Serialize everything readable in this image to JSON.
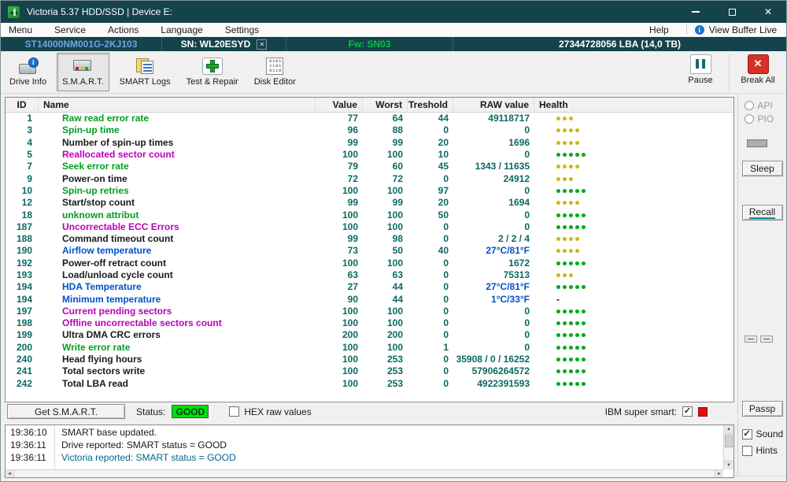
{
  "window": {
    "title": "Victoria 5.37 HDD/SSD | Device E:"
  },
  "icons": {
    "app-icon": "green-drive-logo",
    "minimize-icon": "—",
    "maximize-icon": "▢",
    "close-icon": "✕",
    "view-buffer-info-icon": "ℹ",
    "pause-icon": "❚❚",
    "break-all-icon": "✕",
    "scroll-up": "▲",
    "scroll-down": "▼",
    "scroll-left": "◄",
    "scroll-right": "►"
  },
  "colors": {
    "titlebar_bg": "#15434c",
    "green": "#00a020",
    "black": "#1a1a1a",
    "magenta": "#bb00bb",
    "blue": "#0050cc",
    "value_teal": "#0a6a62",
    "health_green": "#00a81e",
    "health_yellow": "#c9b919",
    "log_blue": "#006688",
    "status_good_bg": "#00e010",
    "model_blue": "#6ea6e0",
    "fw_green": "#00c341",
    "text_black": "#1a1a1a"
  },
  "menu": {
    "items": [
      "Menu",
      "Service",
      "Actions",
      "Language",
      "Settings"
    ],
    "help": "Help",
    "view_buffer_live": "View Buffer Live"
  },
  "device": {
    "model": "ST14000NM001G-2KJ103",
    "serial": "SN: WL20ESYD",
    "firmware": "Fw: SN03",
    "capacity": "27344728056 LBA (14,0 TB)"
  },
  "toolbar": {
    "buttons": [
      {
        "label": "Drive Info",
        "icon": "drive-info-icon",
        "active": false
      },
      {
        "label": "S.M.A.R.T.",
        "icon": "smart-icon",
        "active": true
      },
      {
        "label": "SMART Logs",
        "icon": "smart-logs-icon",
        "active": false
      },
      {
        "label": "Test & Repair",
        "icon": "test-repair-icon",
        "active": false
      },
      {
        "label": "Disk Editor",
        "icon": "disk-editor-icon",
        "active": false
      }
    ],
    "pause_label": "Pause",
    "break_all_label": "Break All"
  },
  "table": {
    "headers": [
      "ID",
      "Name",
      "Value",
      "Worst",
      "Treshold",
      "RAW value",
      "Health"
    ],
    "rows": [
      {
        "id": "1",
        "name": "Raw read error rate",
        "name_color": "green",
        "value": "77",
        "worst": "64",
        "threshold": "44",
        "raw": "49118717",
        "health": {
          "dots": 3,
          "color": "yellow"
        }
      },
      {
        "id": "3",
        "name": "Spin-up time",
        "name_color": "green",
        "value": "96",
        "worst": "88",
        "threshold": "0",
        "raw": "0",
        "health": {
          "dots": 4,
          "color": "yellow"
        }
      },
      {
        "id": "4",
        "name": "Number of spin-up times",
        "name_color": "black",
        "value": "99",
        "worst": "99",
        "threshold": "20",
        "raw": "1696",
        "health": {
          "dots": 4,
          "color": "yellow"
        }
      },
      {
        "id": "5",
        "name": "Reallocated sector count",
        "name_color": "magenta",
        "value": "100",
        "worst": "100",
        "threshold": "10",
        "raw": "0",
        "health": {
          "dots": 5,
          "color": "green"
        }
      },
      {
        "id": "7",
        "name": "Seek error rate",
        "name_color": "green",
        "value": "79",
        "worst": "60",
        "threshold": "45",
        "raw": "1343 / 11635",
        "health": {
          "dots": 4,
          "color": "yellow"
        }
      },
      {
        "id": "9",
        "name": "Power-on time",
        "name_color": "black",
        "value": "72",
        "worst": "72",
        "threshold": "0",
        "raw": "24912",
        "health": {
          "dots": 3,
          "color": "yellow"
        }
      },
      {
        "id": "10",
        "name": "Spin-up retries",
        "name_color": "green",
        "value": "100",
        "worst": "100",
        "threshold": "97",
        "raw": "0",
        "health": {
          "dots": 5,
          "color": "green"
        }
      },
      {
        "id": "12",
        "name": "Start/stop count",
        "name_color": "black",
        "value": "99",
        "worst": "99",
        "threshold": "20",
        "raw": "1694",
        "health": {
          "dots": 4,
          "color": "yellow"
        }
      },
      {
        "id": "18",
        "name": "unknown attribut",
        "name_color": "green",
        "value": "100",
        "worst": "100",
        "threshold": "50",
        "raw": "0",
        "health": {
          "dots": 5,
          "color": "green"
        }
      },
      {
        "id": "187",
        "name": "Uncorrectable ECC Errors",
        "name_color": "magenta",
        "value": "100",
        "worst": "100",
        "threshold": "0",
        "raw": "0",
        "health": {
          "dots": 5,
          "color": "green"
        }
      },
      {
        "id": "188",
        "name": "Command timeout count",
        "name_color": "black",
        "value": "99",
        "worst": "98",
        "threshold": "0",
        "raw": "2 / 2 / 4",
        "health": {
          "dots": 4,
          "color": "yellow"
        }
      },
      {
        "id": "190",
        "name": "Airflow temperature",
        "name_color": "blue",
        "value": "73",
        "worst": "50",
        "threshold": "40",
        "raw": "27°C/81°F",
        "raw_color": "blue",
        "health": {
          "dots": 4,
          "color": "yellow"
        }
      },
      {
        "id": "192",
        "name": "Power-off retract count",
        "name_color": "black",
        "value": "100",
        "worst": "100",
        "threshold": "0",
        "raw": "1672",
        "health": {
          "dots": 5,
          "color": "green"
        }
      },
      {
        "id": "193",
        "name": "Load/unload cycle count",
        "name_color": "black",
        "value": "63",
        "worst": "63",
        "threshold": "0",
        "raw": "75313",
        "health": {
          "dots": 3,
          "color": "yellow"
        }
      },
      {
        "id": "194",
        "name": "HDA Temperature",
        "name_color": "blue",
        "value": "27",
        "worst": "44",
        "threshold": "0",
        "raw": "27°C/81°F",
        "raw_color": "blue",
        "health": {
          "dots": 5,
          "color": "green"
        }
      },
      {
        "id": "194",
        "name": "Minimum temperature",
        "name_color": "blue",
        "value": "90",
        "worst": "44",
        "threshold": "0",
        "raw": "1°C/33°F",
        "raw_color": "blue",
        "health": {
          "dots": 0,
          "color": "none"
        }
      },
      {
        "id": "197",
        "name": "Current pending sectors",
        "name_color": "magenta",
        "value": "100",
        "worst": "100",
        "threshold": "0",
        "raw": "0",
        "health": {
          "dots": 5,
          "color": "green"
        }
      },
      {
        "id": "198",
        "name": "Offline uncorrectable sectors count",
        "name_color": "magenta",
        "value": "100",
        "worst": "100",
        "threshold": "0",
        "raw": "0",
        "health": {
          "dots": 5,
          "color": "green"
        }
      },
      {
        "id": "199",
        "name": "Ultra DMA CRC errors",
        "name_color": "black",
        "value": "200",
        "worst": "200",
        "threshold": "0",
        "raw": "0",
        "health": {
          "dots": 5,
          "color": "green"
        }
      },
      {
        "id": "200",
        "name": "Write error rate",
        "name_color": "green",
        "value": "100",
        "worst": "100",
        "threshold": "1",
        "raw": "0",
        "health": {
          "dots": 5,
          "color": "green"
        }
      },
      {
        "id": "240",
        "name": "Head flying hours",
        "name_color": "black",
        "value": "100",
        "worst": "253",
        "threshold": "0",
        "raw": "35908 / 0 / 16252",
        "health": {
          "dots": 5,
          "color": "green"
        }
      },
      {
        "id": "241",
        "name": "Total sectors write",
        "name_color": "black",
        "value": "100",
        "worst": "253",
        "threshold": "0",
        "raw": "57906264572",
        "health": {
          "dots": 5,
          "color": "green"
        }
      },
      {
        "id": "242",
        "name": "Total LBA read",
        "name_color": "black",
        "value": "100",
        "worst": "253",
        "threshold": "0",
        "raw": "4922391593",
        "health": {
          "dots": 5,
          "color": "green"
        }
      }
    ],
    "health_dash": "-"
  },
  "status_bar": {
    "get_smart_label": "Get S.M.A.R.T.",
    "status_label": "Status:",
    "status_value": "GOOD",
    "hex_label": "HEX raw values",
    "hex_checked": false,
    "ibm_label": "IBM super smart:",
    "ibm_checked": true
  },
  "sidebar": {
    "api_label": "API",
    "pio_label": "PIO",
    "sleep_label": "Sleep",
    "recall_label": "Recall",
    "passp_label": "Passp",
    "sound_label": "Sound",
    "sound_checked": true,
    "hints_label": "Hints",
    "hints_checked": false
  },
  "log": {
    "entries": [
      {
        "time": "19:36:10",
        "message": "SMART base updated.",
        "color": "black"
      },
      {
        "time": "19:36:11",
        "message": "Drive reported: SMART status = GOOD",
        "color": "black"
      },
      {
        "time": "19:36:11",
        "message": "Victoria reported: SMART status = GOOD",
        "color": "blue"
      }
    ]
  }
}
